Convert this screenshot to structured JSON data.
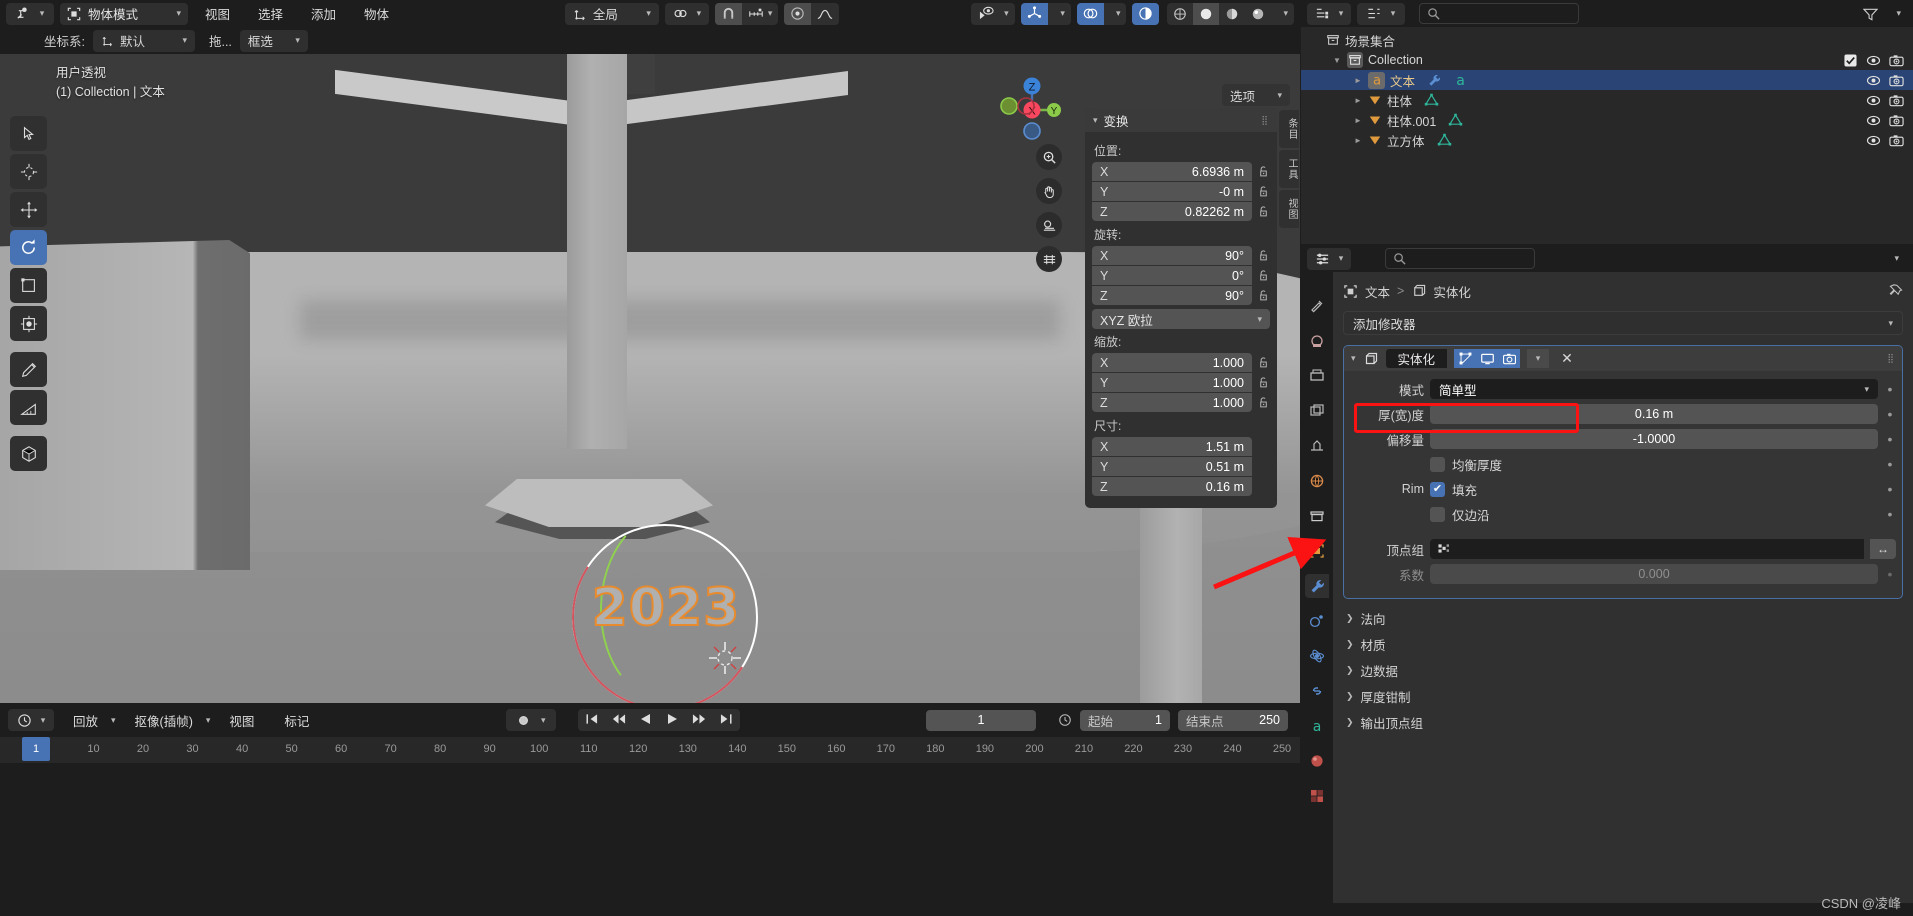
{
  "app": {
    "name": "Blender",
    "watermark": "CSDN @凌峰"
  },
  "topbar": {
    "editor_type_icon": "editor-type-icon",
    "mode": {
      "label": "物体模式",
      "icon": "object-mode-icon"
    },
    "menus": [
      "视图",
      "选择",
      "添加",
      "物体"
    ],
    "orientation": {
      "label": "全局",
      "icon": "orientation-icon"
    },
    "pivot_icon": "pivot-point-icon",
    "snap_icon": "snap-magnet-icon",
    "snap_to_icon": "snap-increment-icon",
    "proportional_icon": "proportional-edit-icon",
    "falloff_icon": "proportional-falloff-icon",
    "visibility_icon": "object-visibility-icon",
    "gizmo_icon": "gizmo-icon",
    "overlay_icon": "overlays-icon",
    "xray_icon": "xray-icon",
    "shading": [
      "wireframe-shading",
      "solid-shading",
      "material-shading",
      "rendered-shading"
    ]
  },
  "topbar2": {
    "transform_label": "坐标系:",
    "transform_value": "默认",
    "drag_label": "拖...",
    "drag_value": "框选"
  },
  "viewport": {
    "info_line1": "用户透视",
    "info_line2": "(1) Collection | 文本",
    "options_label": "选项",
    "tools": [
      "tweak-select-tool",
      "cursor-tool",
      "move-tool",
      "rotate-tool",
      "scale-tool",
      "transform-tool",
      "annotate-tool",
      "measure-tool",
      "add-cube-tool"
    ],
    "active_tool_index": 3,
    "gizmo_axes": [
      "Z",
      "X",
      "Y"
    ],
    "nav_buttons": [
      "zoom-icon",
      "pan-hand-icon",
      "camera-view-icon",
      "toggle-perspective-icon"
    ],
    "text_object_value": "2023",
    "side_tabs": [
      "条目",
      "工具",
      "视图"
    ]
  },
  "npanel": {
    "title": "变换",
    "location": {
      "label": "位置:",
      "rows": [
        {
          "axis": "X",
          "value": "6.6936 m"
        },
        {
          "axis": "Y",
          "value": "-0 m"
        },
        {
          "axis": "Z",
          "value": "0.82262 m"
        }
      ]
    },
    "rotation": {
      "label": "旋转:",
      "rows": [
        {
          "axis": "X",
          "value": "90°"
        },
        {
          "axis": "Y",
          "value": "0°"
        },
        {
          "axis": "Z",
          "value": "90°"
        }
      ],
      "mode": "XYZ 欧拉"
    },
    "scale": {
      "label": "缩放:",
      "rows": [
        {
          "axis": "X",
          "value": "1.000"
        },
        {
          "axis": "Y",
          "value": "1.000"
        },
        {
          "axis": "Z",
          "value": "1.000"
        }
      ]
    },
    "dimensions": {
      "label": "尺寸:",
      "rows": [
        {
          "axis": "X",
          "value": "1.51 m"
        },
        {
          "axis": "Y",
          "value": "0.51 m"
        },
        {
          "axis": "Z",
          "value": "0.16 m"
        }
      ]
    }
  },
  "timeline": {
    "editor_icon": "timeline-editor-icon",
    "menus": [
      "回放",
      "抠像(插帧)",
      "视图",
      "标记"
    ],
    "playback_label": "回放",
    "keying_label": "抠像(插帧)",
    "view_label": "视图",
    "marker_label": "标记",
    "record_icon": "auto-keying-icon",
    "transport": [
      "jump-start-icon",
      "prev-keyframe-icon",
      "play-reverse-icon",
      "play-icon",
      "next-keyframe-icon",
      "jump-end-icon"
    ],
    "current_frame": "1",
    "start_label": "起始",
    "start_value": "1",
    "end_label": "结束点",
    "end_value": "250",
    "playhead_frame": "1",
    "ruler_ticks": [
      "1",
      "10",
      "20",
      "30",
      "40",
      "50",
      "60",
      "70",
      "80",
      "90",
      "100",
      "110",
      "120",
      "130",
      "140",
      "150",
      "160",
      "170",
      "180",
      "190",
      "200",
      "210",
      "220",
      "230",
      "240",
      "250"
    ]
  },
  "outliner": {
    "editor_icon": "outliner-editor-icon",
    "display_mode_icon": "display-mode-icon",
    "search_placeholder": "",
    "filter_icon": "filter-icon",
    "scene_collection": "场景集合",
    "rows": [
      {
        "name": "Collection",
        "icon": "collection-icon",
        "indent": 1,
        "selected": false,
        "has_checkbox": true,
        "expanded": true
      },
      {
        "name": "文本",
        "icon": "font-object-icon",
        "indent": 2,
        "selected": true,
        "modifier_icon": "wrench-icon",
        "data_icon": "font-data-icon"
      },
      {
        "name": "柱体",
        "icon": "mesh-object-icon",
        "indent": 2,
        "selected": false,
        "data_icon": "mesh-data-icon"
      },
      {
        "name": "柱体.001",
        "icon": "mesh-object-icon",
        "indent": 2,
        "selected": false,
        "data_icon": "mesh-data-icon"
      },
      {
        "name": "立方体",
        "icon": "mesh-object-icon",
        "indent": 2,
        "selected": false,
        "data_icon": "mesh-data-icon"
      }
    ]
  },
  "properties": {
    "editor_icon": "properties-editor-icon",
    "search_placeholder": "",
    "breadcrumb": {
      "object": "文本",
      "separator": ">",
      "modifier": "实体化"
    },
    "pin_icon": "pin-icon",
    "add_modifier": "添加修改器",
    "tabs": [
      "tool-tab",
      "render-tab",
      "output-tab",
      "view-layer-tab",
      "scene-tab",
      "world-tab",
      "collection-tab",
      "object-tab",
      "modifier-tab",
      "particles-tab",
      "physics-tab",
      "constraints-tab",
      "data-tab",
      "material-tab",
      "texture-tab"
    ],
    "active_tab": "modifier-tab",
    "modifier": {
      "name": "实体化",
      "icon": "solidify-icon",
      "toggles": [
        "edit-mode-display",
        "realtime-display",
        "render-display"
      ],
      "dropdown_icon": "chevron-down-icon",
      "close_icon": "close-icon",
      "drag_icon": "drag-dots-icon",
      "rows": [
        {
          "label": "模式",
          "value": "简单型",
          "type": "dropdown"
        },
        {
          "label": "厚(宽)度",
          "value": "0.16 m",
          "type": "value",
          "highlighted": true
        },
        {
          "label": "偏移量",
          "value": "-1.0000",
          "type": "value"
        },
        {
          "label": "",
          "value": "均衡厚度",
          "type": "checkbox",
          "checked": false
        },
        {
          "label": "Rim",
          "value": "填充",
          "type": "checkbox",
          "checked": true
        },
        {
          "label": "",
          "value": "仅边沿",
          "type": "checkbox",
          "checked": false
        }
      ],
      "vertex_group": {
        "label": "顶点组",
        "value": "",
        "swap_icon": "swap-icon"
      },
      "factor": {
        "label": "系数",
        "value": "0.000",
        "disabled": true
      },
      "sections": [
        "法向",
        "材质",
        "边数据",
        "厚度钳制",
        "输出顶点组"
      ]
    }
  },
  "colors": {
    "accent_blue": "#4772b3",
    "highlight_red": "#fb1212",
    "selection_orange": "#e88b2e",
    "panel_bg": "#303030",
    "editor_bg": "#282828",
    "header_bg": "#1d1d1d"
  }
}
